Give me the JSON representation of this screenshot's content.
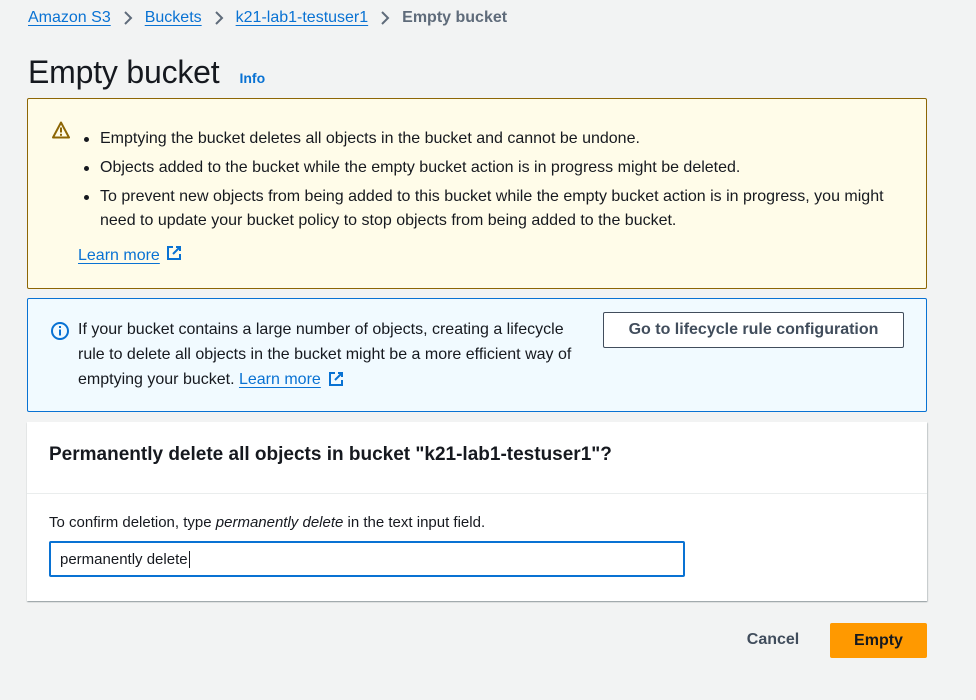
{
  "breadcrumb": {
    "items": [
      "Amazon S3",
      "Buckets",
      "k21-lab1-testuser1"
    ],
    "current": "Empty bucket"
  },
  "page": {
    "title": "Empty bucket",
    "info_link": "Info"
  },
  "warning": {
    "icon": "warning-triangle-icon",
    "bullets": [
      "Emptying the bucket deletes all objects in the bucket and cannot be undone.",
      "Objects added to the bucket while the empty bucket action is in progress might be deleted.",
      "To prevent new objects from being added to this bucket while the empty bucket action is in progress, you might need to update your bucket policy to stop objects from being added to the bucket."
    ],
    "learn_more": "Learn more"
  },
  "info_alert": {
    "icon": "info-circle-icon",
    "text": "If your bucket contains a large number of objects, creating a lifecycle rule to delete all objects in the bucket might be a more efficient way of emptying your bucket.",
    "learn_more": "Learn more",
    "button_label": "Go to lifecycle rule configuration"
  },
  "confirm": {
    "title": "Permanently delete all objects in bucket \"k21-lab1-testuser1\"?",
    "instruction_prefix": "To confirm deletion, type ",
    "instruction_phrase": "permanently delete",
    "instruction_suffix": " in the text input field.",
    "input_value": "permanently delete"
  },
  "actions": {
    "cancel_label": "Cancel",
    "empty_label": "Empty"
  },
  "colors": {
    "link": "#0972d3",
    "warning_bg": "#fffce9",
    "warning_border": "#8d6605",
    "info_bg": "#f1faff",
    "primary_button": "#ff9900"
  }
}
